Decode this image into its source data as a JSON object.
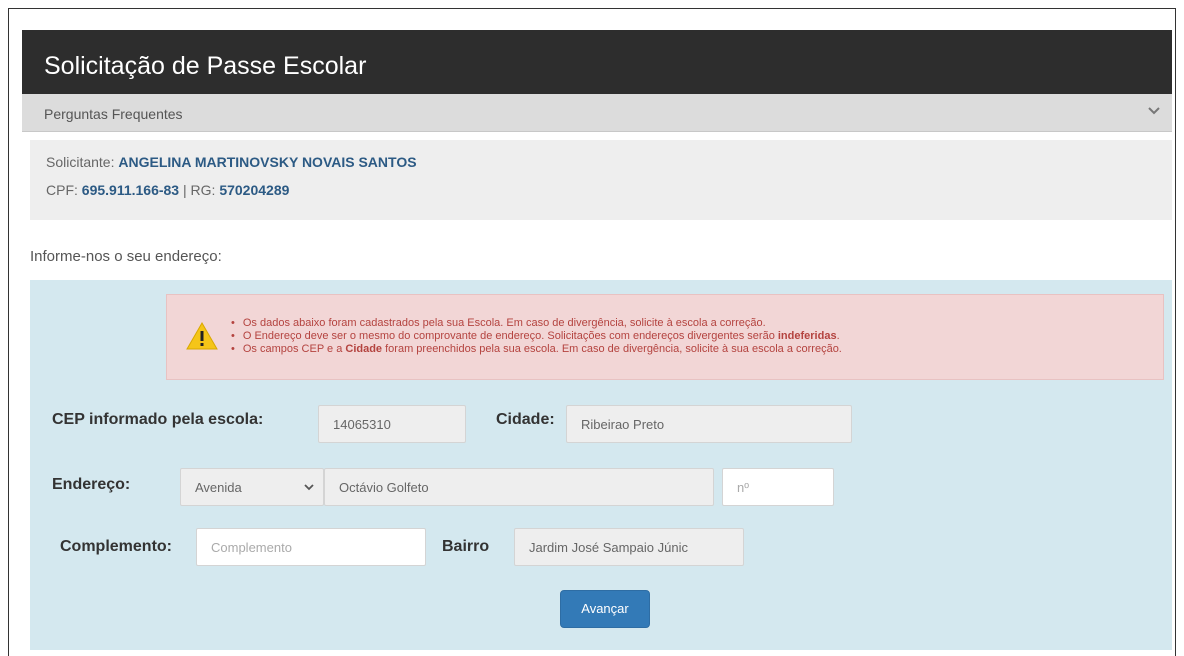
{
  "header": {
    "title": "Solicitação de Passe Escolar"
  },
  "faq": {
    "label": "Perguntas Frequentes"
  },
  "applicant": {
    "name_label": "Solicitante:",
    "name": "ANGELINA MARTINOVSKY NOVAIS SANTOS",
    "cpf_label": "CPF:",
    "cpf": "695.911.166-83",
    "separator": "|",
    "rg_label": "RG:",
    "rg": "570204289"
  },
  "prompt": "Informe-nos o seu endereço:",
  "alert": {
    "line1": "Os dados abaixo foram cadastrados pela sua Escola. Em caso de divergência, solicite à escola a correção.",
    "line2_pre": "O Endereço deve ser o mesmo do comprovante de endereço. Solicitações com endereços divergentes serão ",
    "line2_bold": "indeferidas",
    "line2_post": ".",
    "line3_pre": "Os campos CEP e a ",
    "line3_bold": "Cidade",
    "line3_post": " foram preenchidos pela sua escola. Em caso de divergência, solicite à sua escola a correção."
  },
  "form": {
    "cep_label": "CEP informado pela escola:",
    "cep_value": "14065310",
    "cidade_label": "Cidade:",
    "cidade_value": "Ribeirao Preto",
    "endereco_label": "Endereço:",
    "tipo_value": "Avenida",
    "logradouro_value": "Octávio Golfeto",
    "numero_placeholder": "nº",
    "complemento_label": "Complemento:",
    "complemento_placeholder": "Complemento",
    "bairro_label": "Bairro",
    "bairro_value": "Jardim José Sampaio Júnic"
  },
  "actions": {
    "next_label": "Avançar"
  },
  "colors": {
    "header_bg": "#2d2d2d",
    "panel_bg": "#d4e8ef",
    "alert_bg": "#f2d6d6",
    "alert_text": "#b4433f",
    "button_bg": "#337ab7",
    "accent_text": "#2c5a84"
  },
  "icons": {
    "faq_toggle": "chevron-down-icon",
    "alert": "warning-icon",
    "select_toggle": "chevron-down-icon"
  }
}
